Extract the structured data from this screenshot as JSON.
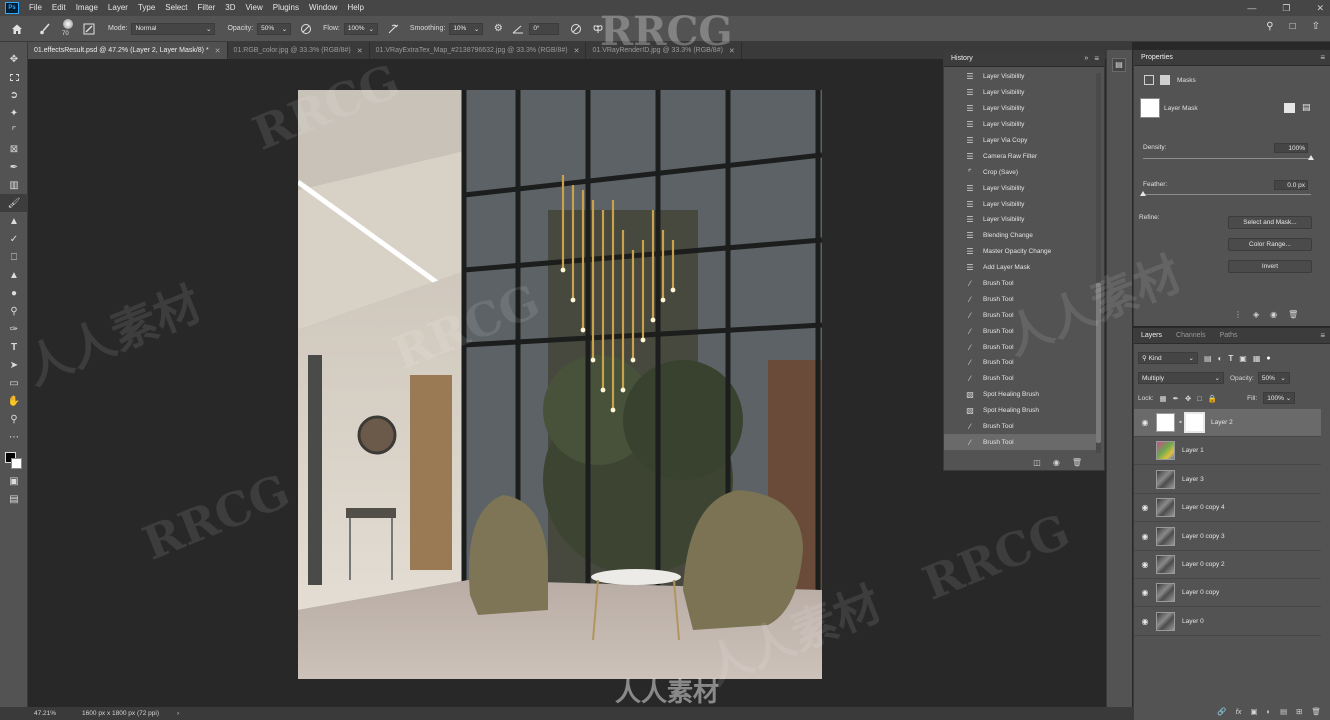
{
  "app": {
    "logo": "Ps"
  },
  "menu": [
    "File",
    "Edit",
    "Image",
    "Layer",
    "Type",
    "Select",
    "Filter",
    "3D",
    "View",
    "Plugins",
    "Window",
    "Help"
  ],
  "options_bar": {
    "brush_size": "70",
    "mode_label": "Mode:",
    "mode_value": "Normal",
    "opacity_label": "Opacity:",
    "opacity_value": "50%",
    "flow_label": "Flow:",
    "flow_value": "100%",
    "smoothing_label": "Smoothing:",
    "smoothing_value": "10%",
    "angle_value": "0°"
  },
  "doc_tabs": [
    "01.effectsResult.psd @ 47.2% (Layer 2, Layer Mask/8) *",
    "01.RGB_color.jpg @ 33.3% (RGB/8#)",
    "01.VRayExtraTex_Map_#2138796632.jpg @ 33.3% (RGB/8#)",
    "01.VRayRenderID.jpg @ 33.3% (RGB/8#)"
  ],
  "history": {
    "title": "History",
    "items": [
      "Layer Visibility",
      "Layer Visibility",
      "Layer Visibility",
      "Layer Visibility",
      "Layer Via Copy",
      "Camera Raw Filter",
      "Crop (Save)",
      "Layer Visibility",
      "Layer Visibility",
      "Layer Visibility",
      "Blending Change",
      "Master Opacity Change",
      "Add Layer Mask",
      "Brush Tool",
      "Brush Tool",
      "Brush Tool",
      "Brush Tool",
      "Brush Tool",
      "Brush Tool",
      "Brush Tool",
      "Spot Healing Brush",
      "Spot Healing Brush",
      "Brush Tool",
      "Brush Tool"
    ]
  },
  "properties": {
    "title": "Properties",
    "masks_label": "Masks",
    "layer_mask_label": "Layer Mask",
    "density_label": "Density:",
    "density_value": "100%",
    "density_level": 1.0,
    "feather_label": "Feather:",
    "feather_value": "0.0 px",
    "feather_level": 0.0,
    "refine_label": "Refine:",
    "select_mask_btn": "Select and Mask...",
    "color_range_btn": "Color Range...",
    "invert_btn": "Invert"
  },
  "layers": {
    "tabs": [
      "Layers",
      "Channels",
      "Paths"
    ],
    "filter_kind": "Kind",
    "blend_mode": "Multiply",
    "opacity_label": "Opacity:",
    "opacity_value": "50%",
    "lock_label": "Lock:",
    "fill_label": "Fill:",
    "fill_value": "100%",
    "items": [
      {
        "name": "Layer 2",
        "visible": true
      },
      {
        "name": "Layer 1",
        "visible": false
      },
      {
        "name": "Layer 3",
        "visible": false
      },
      {
        "name": "Layer 0 copy 4",
        "visible": true
      },
      {
        "name": "Layer 0 copy 3",
        "visible": true
      },
      {
        "name": "Layer 0 copy 2",
        "visible": true
      },
      {
        "name": "Layer 0 copy",
        "visible": true
      },
      {
        "name": "Layer 0",
        "visible": true
      }
    ]
  },
  "status": {
    "zoom": "47.21%",
    "doc_size": "1600 px x 1800 px (72 ppi)"
  },
  "watermark": {
    "latin": "RRCG",
    "cjk": "人人素材"
  }
}
